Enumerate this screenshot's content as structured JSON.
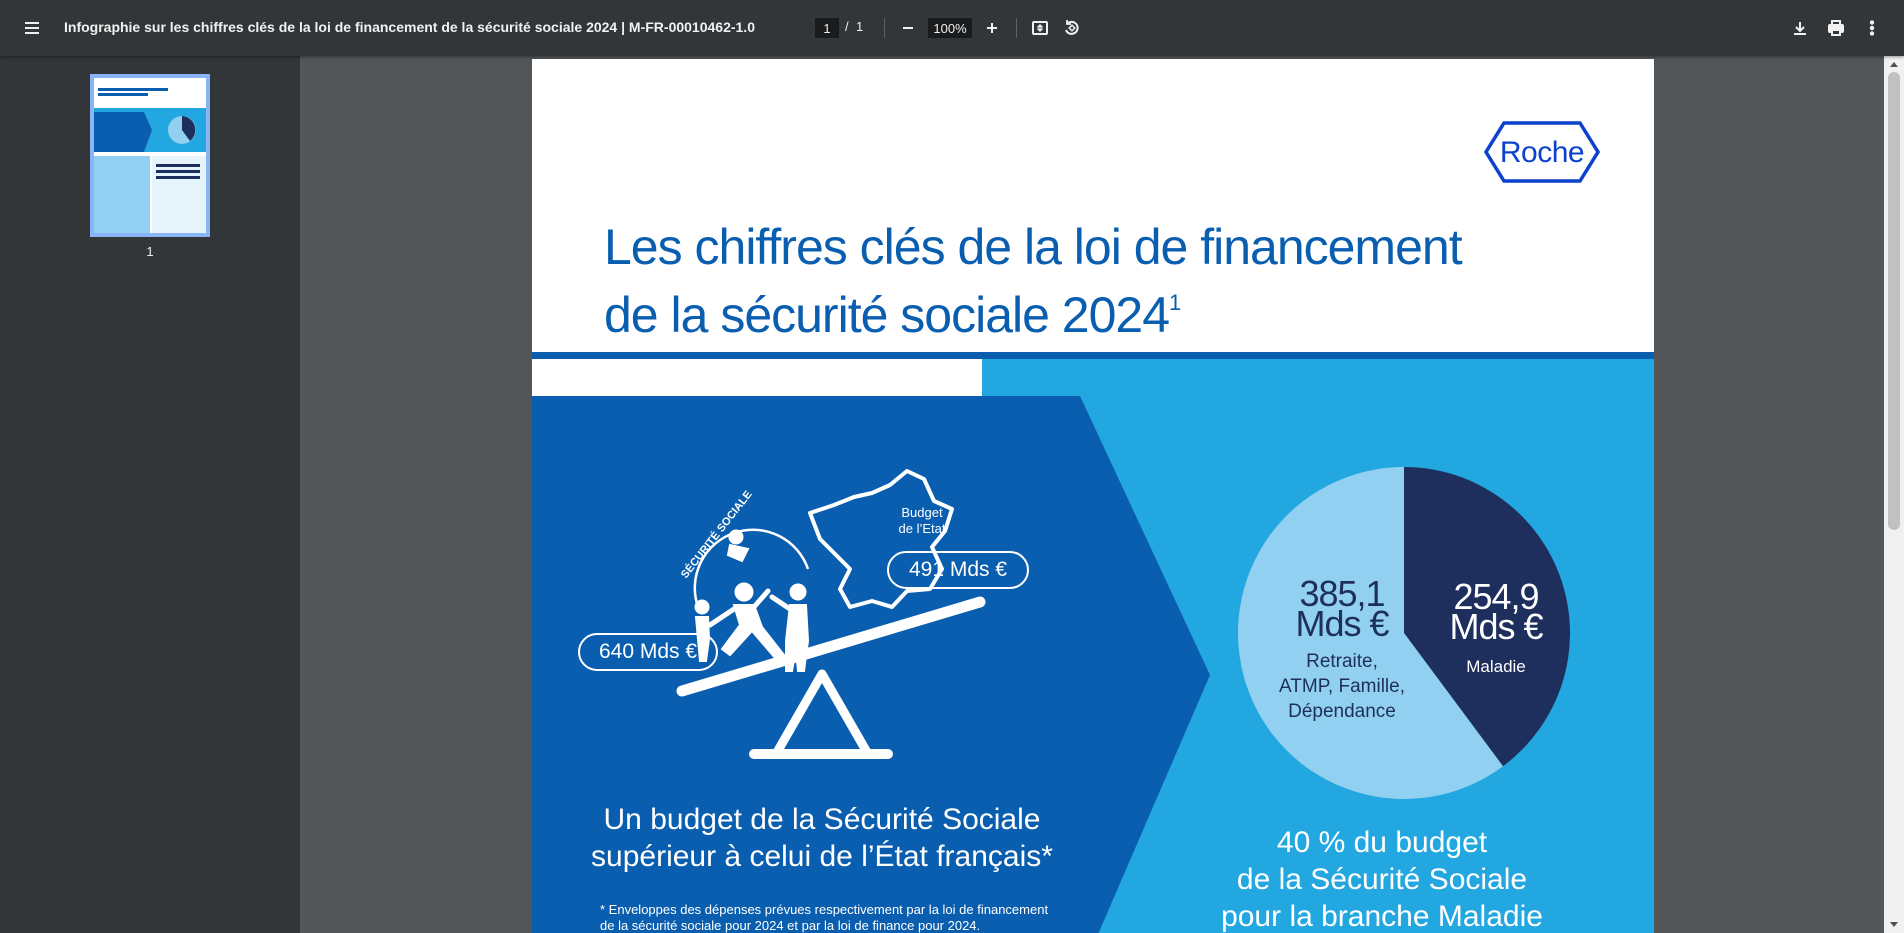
{
  "toolbar": {
    "doc_title": "Infographie sur les chiffres clés de la loi de financement de la sécurité sociale 2024 | M-FR-00010462-1.0",
    "page_current": "1",
    "page_separator": "/",
    "page_total": "1",
    "zoom": "100%",
    "icons": [
      "menu-icon",
      "zoom-out-icon",
      "zoom-in-icon",
      "fit-page-icon",
      "rotate-icon",
      "download-icon",
      "print-icon",
      "more-vert-icon"
    ]
  },
  "sidebar": {
    "thumbnails": [
      {
        "label": "1"
      }
    ]
  },
  "document": {
    "logo_text": "Roche",
    "title_line1": "Les chiffres clés de la loi de financement",
    "title_line2": "de la sécurité sociale 2024",
    "title_sup": "1",
    "illustration": {
      "arc_label": "SÉCURITÉ SOCIALE",
      "ss_amount": "640 Mds €",
      "etat_label_line1": "Budget",
      "etat_label_line2": "de l’Etat",
      "etat_amount": "491 Mds €"
    },
    "budget_heading_line1": "Un budget de la Sécurité Sociale",
    "budget_heading_line2": "supérieur à celui de l’État français*",
    "footnote_line1": "* Enveloppes des dépenses prévues respectivement par la loi de financement",
    "footnote_line2": "de la sécurité sociale pour 2024 et par la loi de finance pour 2024.",
    "maladie_heading_line1": "40 % du budget",
    "maladie_heading_line2": "de la Sécurité Sociale",
    "maladie_heading_line3": "pour la branche Maladie",
    "colors": {
      "title_blue": "#0a5eb0",
      "dark_panel": "#0a5eb0",
      "light_panel": "#23a7e0",
      "pie_light": "#91d0f0",
      "pie_dark": "#1e2f5e"
    }
  },
  "chart_data": {
    "type": "pie",
    "slices": [
      {
        "value_line1": "254,9",
        "value_line2": "Mds €",
        "label": "Maladie",
        "value": 254.9,
        "color": "#1e2f5e"
      },
      {
        "value_line1": "385,1",
        "value_line2": "Mds €",
        "label_lines": [
          "Retraite,",
          "ATMP, Famille,",
          "Dépendance"
        ],
        "value": 385.1,
        "color": "#91d0f0"
      }
    ],
    "unit": "Mds €"
  }
}
